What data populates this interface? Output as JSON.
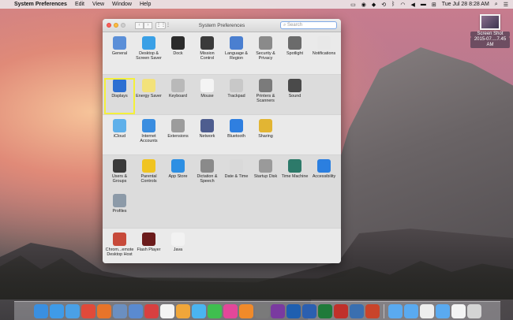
{
  "menubar": {
    "app_name": "System Preferences",
    "items": [
      "Edit",
      "View",
      "Window",
      "Help"
    ],
    "clock": "Tue Jul 28  8:28 AM"
  },
  "desktop_file": {
    "name_line1": "Screen Shot",
    "name_line2": "2015-07....7.45 AM"
  },
  "window": {
    "title": "System Preferences",
    "search_placeholder": "Search",
    "sections": {
      "personal": [
        {
          "label": "General",
          "icon": "general-icon",
          "color": "#5b8fd8"
        },
        {
          "label": "Desktop & Screen Saver",
          "icon": "desktop-icon",
          "color": "#3aa0e6"
        },
        {
          "label": "Dock",
          "icon": "dock-icon",
          "color": "#2b2b2b"
        },
        {
          "label": "Mission Control",
          "icon": "mission-control-icon",
          "color": "#3a3a3a"
        },
        {
          "label": "Language & Region",
          "icon": "language-icon",
          "color": "#4a7fd0"
        },
        {
          "label": "Security & Privacy",
          "icon": "security-icon",
          "color": "#8a8a8a"
        },
        {
          "label": "Spotlight",
          "icon": "spotlight-icon",
          "color": "#6b6b6b"
        },
        {
          "label": "Notifications",
          "icon": "notifications-icon",
          "color": "#e8e8e8"
        }
      ],
      "hardware": [
        {
          "label": "Displays",
          "icon": "displays-icon",
          "color": "#2d6fd2",
          "selected": true
        },
        {
          "label": "Energy Saver",
          "icon": "energy-saver-icon",
          "color": "#f3e27a"
        },
        {
          "label": "Keyboard",
          "icon": "keyboard-icon",
          "color": "#b9b9b9"
        },
        {
          "label": "Mouse",
          "icon": "mouse-icon",
          "color": "#f4f4f4"
        },
        {
          "label": "Trackpad",
          "icon": "trackpad-icon",
          "color": "#c8c8c8"
        },
        {
          "label": "Printers & Scanners",
          "icon": "printer-icon",
          "color": "#7b7b7b"
        },
        {
          "label": "Sound",
          "icon": "sound-icon",
          "color": "#4a4a4a"
        }
      ],
      "internet": [
        {
          "label": "iCloud",
          "icon": "icloud-icon",
          "color": "#5fb0ea"
        },
        {
          "label": "Internet Accounts",
          "icon": "internet-accounts-icon",
          "color": "#3a8de0"
        },
        {
          "label": "Extensions",
          "icon": "extensions-icon",
          "color": "#9c9c9c"
        },
        {
          "label": "Network",
          "icon": "network-icon",
          "color": "#4e5d8f"
        },
        {
          "label": "Bluetooth",
          "icon": "bluetooth-icon",
          "color": "#2f7fe0"
        },
        {
          "label": "Sharing",
          "icon": "sharing-icon",
          "color": "#e2b533"
        }
      ],
      "system": [
        {
          "label": "Users & Groups",
          "icon": "users-icon",
          "color": "#3a3a3a"
        },
        {
          "label": "Parental Controls",
          "icon": "parental-icon",
          "color": "#f0c421"
        },
        {
          "label": "App Store",
          "icon": "app-store-icon",
          "color": "#2d8fe3"
        },
        {
          "label": "Dictation & Speech",
          "icon": "dictation-icon",
          "color": "#8a8a8a"
        },
        {
          "label": "Date & Time",
          "icon": "date-time-icon",
          "color": "#d9d9d9"
        },
        {
          "label": "Startup Disk",
          "icon": "startup-disk-icon",
          "color": "#9a9a9a"
        },
        {
          "label": "Time Machine",
          "icon": "time-machine-icon",
          "color": "#2d7a6a"
        },
        {
          "label": "Accessibility",
          "icon": "accessibility-icon",
          "color": "#2b7fe0"
        },
        {
          "label": "Profiles",
          "icon": "profiles-icon",
          "color": "#8c9aa8"
        }
      ],
      "other": [
        {
          "label": "Chrom...emote Desktop Host",
          "icon": "chrome-remote-icon",
          "color": "#c74a3a"
        },
        {
          "label": "Flash Player",
          "icon": "flash-icon",
          "color": "#6b1b1b"
        },
        {
          "label": "Java",
          "icon": "java-icon",
          "color": "#f2f2f2"
        }
      ]
    }
  },
  "dock": [
    {
      "name": "finder-icon",
      "color": "#3a8fe0"
    },
    {
      "name": "safari-icon",
      "color": "#3f9be8"
    },
    {
      "name": "compass-icon",
      "color": "#4aa0e6"
    },
    {
      "name": "chrome-icon",
      "color": "#e04a3a"
    },
    {
      "name": "firefox-icon",
      "color": "#e8742a"
    },
    {
      "name": "preview-icon",
      "color": "#6b8fc0"
    },
    {
      "name": "mail-icon",
      "color": "#5a8ad0"
    },
    {
      "name": "recorder-icon",
      "color": "#d84040"
    },
    {
      "name": "calendar-icon",
      "color": "#f4f4f4"
    },
    {
      "name": "photos-icon",
      "color": "#f0a63a"
    },
    {
      "name": "messages-icon",
      "color": "#4ab4f0"
    },
    {
      "name": "facetime-icon",
      "color": "#3fbf4f"
    },
    {
      "name": "itunes-icon",
      "color": "#e3479a"
    },
    {
      "name": "ibooks-icon",
      "color": "#f08a2a"
    },
    {
      "name": "system-preferences-icon",
      "color": "#7a7a7a"
    },
    {
      "name": "onenote-icon",
      "color": "#7a3aa0"
    },
    {
      "name": "outlook-icon",
      "color": "#1f5fb0"
    },
    {
      "name": "word-icon",
      "color": "#2b5fb0"
    },
    {
      "name": "excel-icon",
      "color": "#1f7a3a"
    },
    {
      "name": "photo-booth-icon",
      "color": "#c0302a"
    },
    {
      "name": "network-utility-icon",
      "color": "#3a6fb0"
    },
    {
      "name": "powerpoint-icon",
      "color": "#c9442a"
    },
    {
      "name": "folder-icon",
      "color": "#5aaaf0"
    },
    {
      "name": "downloads-folder-icon",
      "color": "#5aaaf0"
    },
    {
      "name": "document-icon",
      "color": "#eeeeee"
    },
    {
      "name": "applications-folder-icon",
      "color": "#5aaaf0"
    },
    {
      "name": "file-icon",
      "color": "#f4f4f4"
    },
    {
      "name": "trash-icon",
      "color": "#d4d4d4"
    }
  ]
}
